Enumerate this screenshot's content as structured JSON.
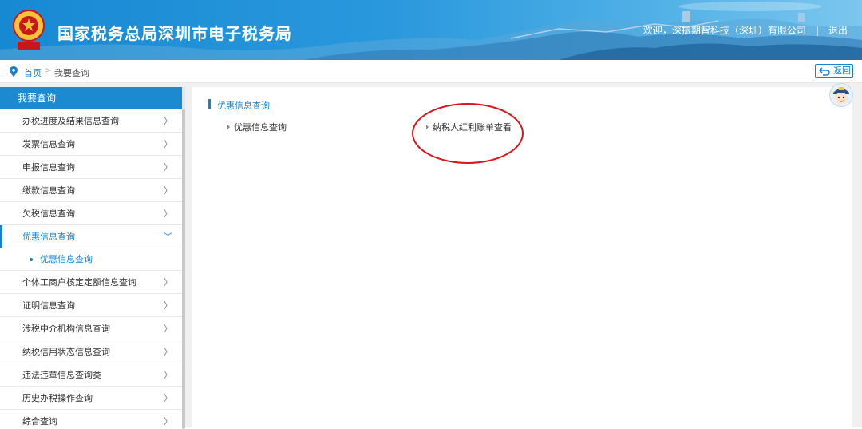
{
  "header": {
    "title": "国家税务总局深圳市电子税务局",
    "welcome": "欢迎，",
    "company": "深振期智科技（深圳）有限公司",
    "separator": "|",
    "logout": "退出",
    "emblem_icon": "tax-emblem-icon",
    "colors": {
      "bar": "#1789d3",
      "text": "#ffffff"
    }
  },
  "breadcrumb": {
    "home": "首页",
    "arrow": ">",
    "current": "我要查询",
    "back_label": "返回",
    "pin_icon": "location-pin-icon",
    "back_icon": "return-arrow-icon"
  },
  "sidebar": {
    "title": "我要查询",
    "items": [
      {
        "label": "办税进度及结果信息查询",
        "chevron": "〉"
      },
      {
        "label": "发票信息查询",
        "chevron": "〉"
      },
      {
        "label": "申报信息查询",
        "chevron": "〉"
      },
      {
        "label": "缴款信息查询",
        "chevron": "〉"
      },
      {
        "label": "欠税信息查询",
        "chevron": "〉"
      },
      {
        "label": "优惠信息查询",
        "chevron": "﹀",
        "active": true
      },
      {
        "label": "个体工商户核定定额信息查询",
        "chevron": "〉"
      },
      {
        "label": "证明信息查询",
        "chevron": "〉"
      },
      {
        "label": "涉税中介机构信息查询",
        "chevron": "〉"
      },
      {
        "label": "纳税信用状态信息查询",
        "chevron": "〉"
      },
      {
        "label": "违法违章信息查询类",
        "chevron": "〉"
      },
      {
        "label": "历史办税操作查询",
        "chevron": "〉"
      },
      {
        "label": "综合查询",
        "chevron": "〉"
      }
    ],
    "sub_item": "优惠信息查询",
    "accent": "#1c80c9"
  },
  "main": {
    "section_title": "优惠信息查询",
    "links": [
      {
        "label": "优惠信息查询"
      },
      {
        "label": "纳税人红利账单查看"
      }
    ],
    "avatar_icon": "assistant-avatar-icon",
    "annotation_color": "#d9161c"
  }
}
